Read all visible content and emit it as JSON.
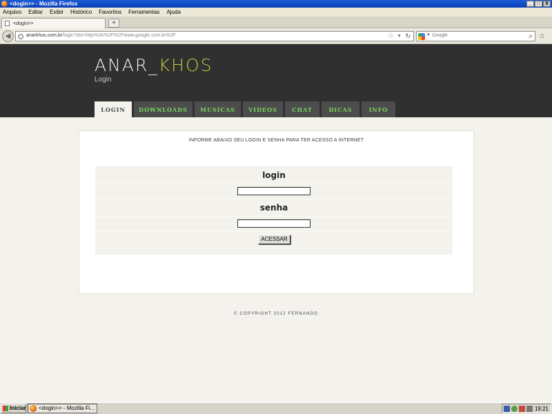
{
  "window": {
    "title": "<dogin>> - Mozilla Firefox",
    "minimize": "_",
    "maximize": "□",
    "close": "X"
  },
  "menubar": {
    "items": [
      "Arquivo",
      "Editar",
      "Exibir",
      "Histórico",
      "Favoritos",
      "Ferramentas",
      "Ajuda"
    ]
  },
  "browser": {
    "tab_label": "<dogin>>",
    "new_tab": "+",
    "back": "◀",
    "url_domain": "anarkhos.com.br",
    "url_path": "/login?dst=http%3A%2F%2Fwww.google.com.br%2F",
    "star": "☆",
    "dropdown": "▼",
    "reload": "↻",
    "search_placeholder": "Google",
    "search_caret": "▼",
    "search_glass": "⌕",
    "home": "⌂"
  },
  "site": {
    "logo_main": "ANAR_",
    "logo_accent": "KHOS",
    "subtitle": "Login",
    "nav": [
      {
        "label": "LOGIN",
        "active": true
      },
      {
        "label": "DOWNLOADS",
        "active": false
      },
      {
        "label": "MUSICAS",
        "active": false
      },
      {
        "label": "VIDEOS",
        "active": false
      },
      {
        "label": "CHAT",
        "active": false
      },
      {
        "label": "DICAS",
        "active": false
      },
      {
        "label": "INFO",
        "active": false
      }
    ],
    "instruction": "INFORME ABAIXO SEU LOGIN E SENHA PARA TER ACESSO A INTERNET",
    "form": {
      "login_label": "login",
      "login_value": "",
      "senha_label": "senha",
      "senha_value": "",
      "submit_label": "ACESSAR"
    },
    "footer": "© COPYRIGHT 2012 FERNANDO"
  },
  "taskbar": {
    "start_label": "Iniciar",
    "task_label": "<dogin>> - Mozilla Fi...",
    "clock": "19:21"
  },
  "colors": {
    "header_bg": "#303030",
    "logo_accent": "#c2cb3f",
    "nav_text": "#78d957",
    "page_bg": "#f4f2ec"
  }
}
